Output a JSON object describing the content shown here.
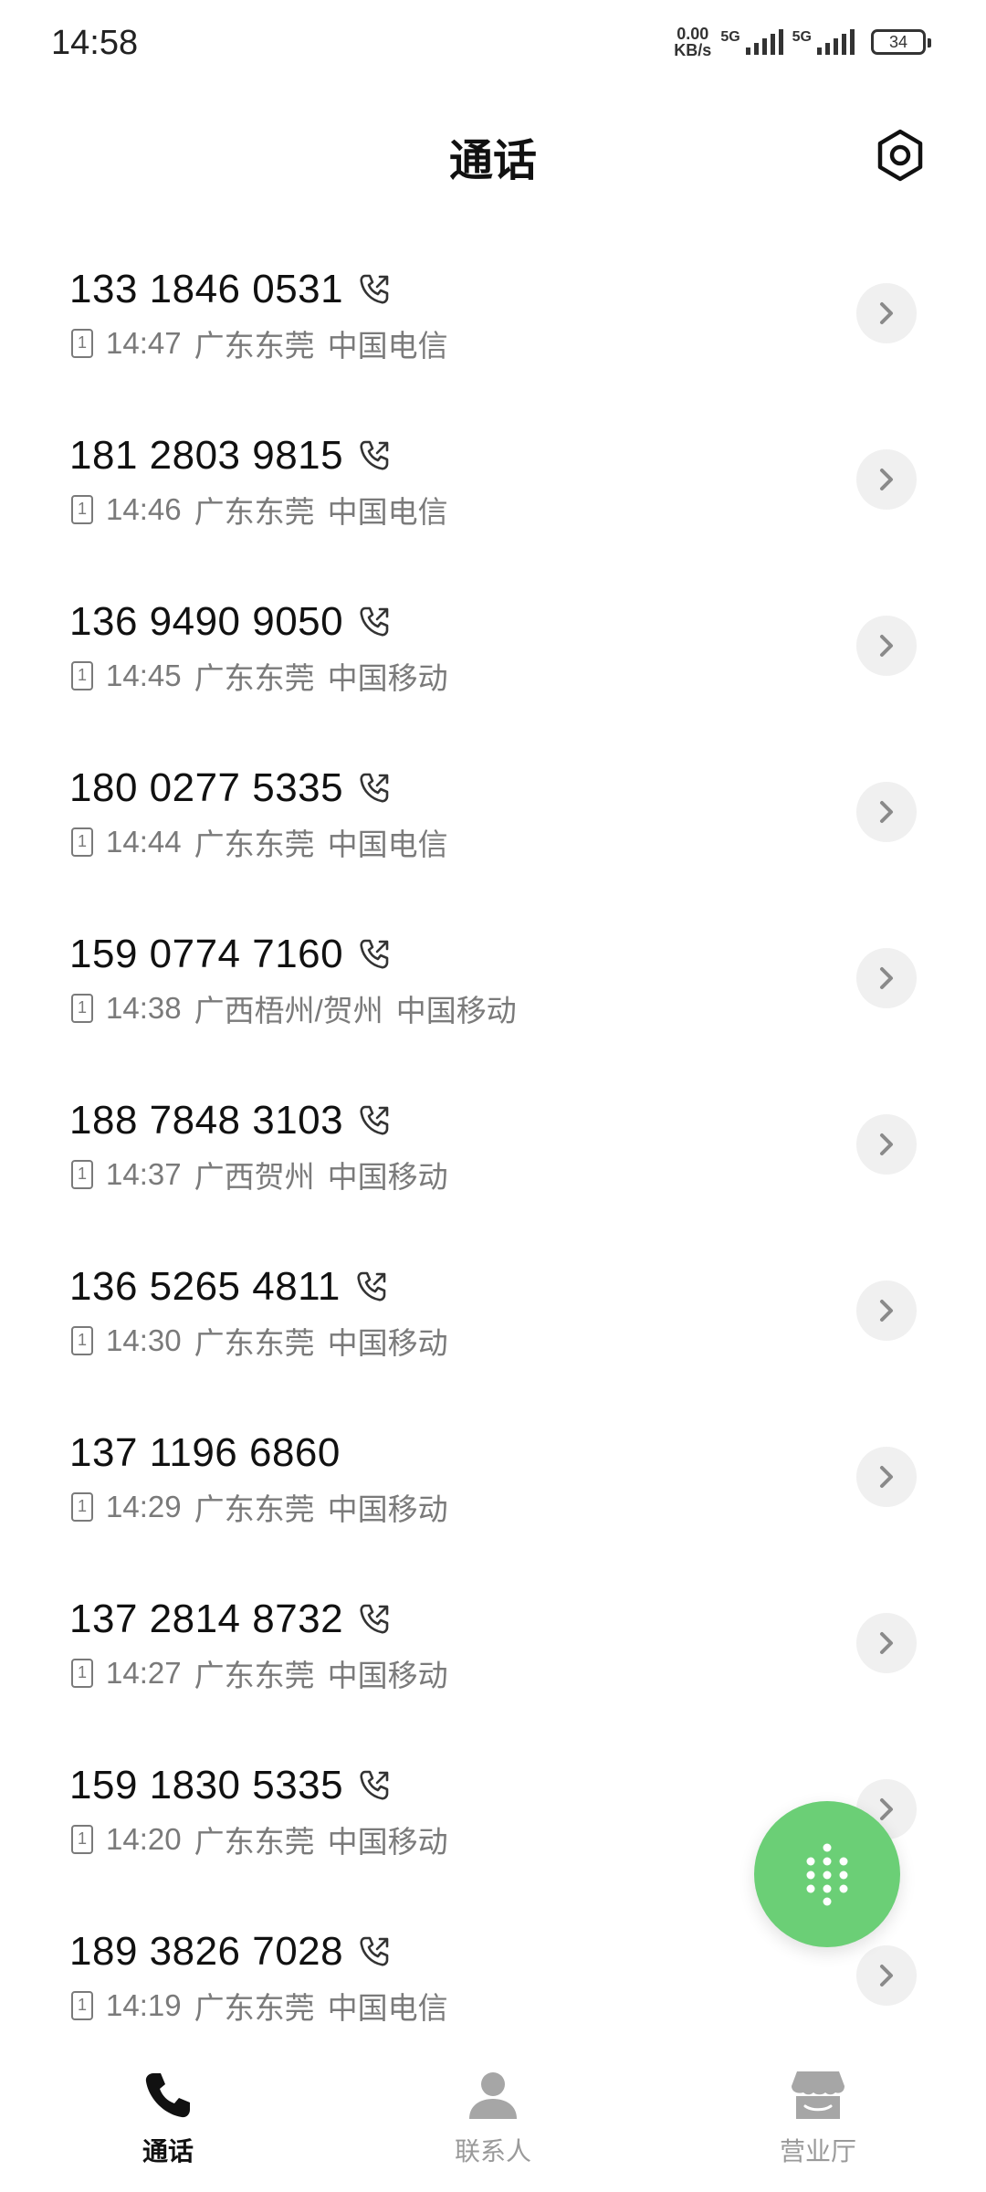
{
  "status_bar": {
    "time": "14:58",
    "net_speed_value": "0.00",
    "net_speed_unit": "KB/s",
    "sim1_gen": "5G",
    "sim2_gen": "5G",
    "battery": "34"
  },
  "header": {
    "title": "通话"
  },
  "calls": [
    {
      "number": "133 1846 0531",
      "time": "14:47",
      "location": "广东东莞",
      "carrier": "中国电信",
      "sim": "1",
      "show_call_icon": true
    },
    {
      "number": "181 2803 9815",
      "time": "14:46",
      "location": "广东东莞",
      "carrier": "中国电信",
      "sim": "1",
      "show_call_icon": true
    },
    {
      "number": "136 9490 9050",
      "time": "14:45",
      "location": "广东东莞",
      "carrier": "中国移动",
      "sim": "1",
      "show_call_icon": true
    },
    {
      "number": "180 0277 5335",
      "time": "14:44",
      "location": "广东东莞",
      "carrier": "中国电信",
      "sim": "1",
      "show_call_icon": true
    },
    {
      "number": "159 0774 7160",
      "time": "14:38",
      "location": "广西梧州/贺州",
      "carrier": "中国移动",
      "sim": "1",
      "show_call_icon": true
    },
    {
      "number": "188 7848 3103",
      "time": "14:37",
      "location": "广西贺州",
      "carrier": "中国移动",
      "sim": "1",
      "show_call_icon": true
    },
    {
      "number": "136 5265 4811",
      "time": "14:30",
      "location": "广东东莞",
      "carrier": "中国移动",
      "sim": "1",
      "show_call_icon": true
    },
    {
      "number": "137 1196 6860",
      "time": "14:29",
      "location": "广东东莞",
      "carrier": "中国移动",
      "sim": "1",
      "show_call_icon": false
    },
    {
      "number": "137 2814 8732",
      "time": "14:27",
      "location": "广东东莞",
      "carrier": "中国移动",
      "sim": "1",
      "show_call_icon": true
    },
    {
      "number": "159 1830 5335",
      "time": "14:20",
      "location": "广东东莞",
      "carrier": "中国移动",
      "sim": "1",
      "show_call_icon": true
    },
    {
      "number": "189 3826 7028",
      "time": "14:19",
      "location": "广东东莞",
      "carrier": "中国电信",
      "sim": "1",
      "show_call_icon": true
    }
  ],
  "bottom_nav": {
    "calls_label": "通话",
    "contacts_label": "联系人",
    "hall_label": "营业厅"
  },
  "icons": {
    "settings": "settings-hexagon-icon",
    "outgoing_call": "outgoing-call-icon",
    "sim": "sim-1-icon",
    "detail": "chevron-right-icon",
    "dialpad": "dialpad-icon",
    "nav_calls": "phone-icon",
    "nav_contacts": "person-icon",
    "nav_hall": "store-icon"
  },
  "colors": {
    "accent_green": "#6bcf76",
    "text_primary": "#111111",
    "text_secondary": "#7a7a7a",
    "detail_button_bg": "#f0f0f0"
  }
}
